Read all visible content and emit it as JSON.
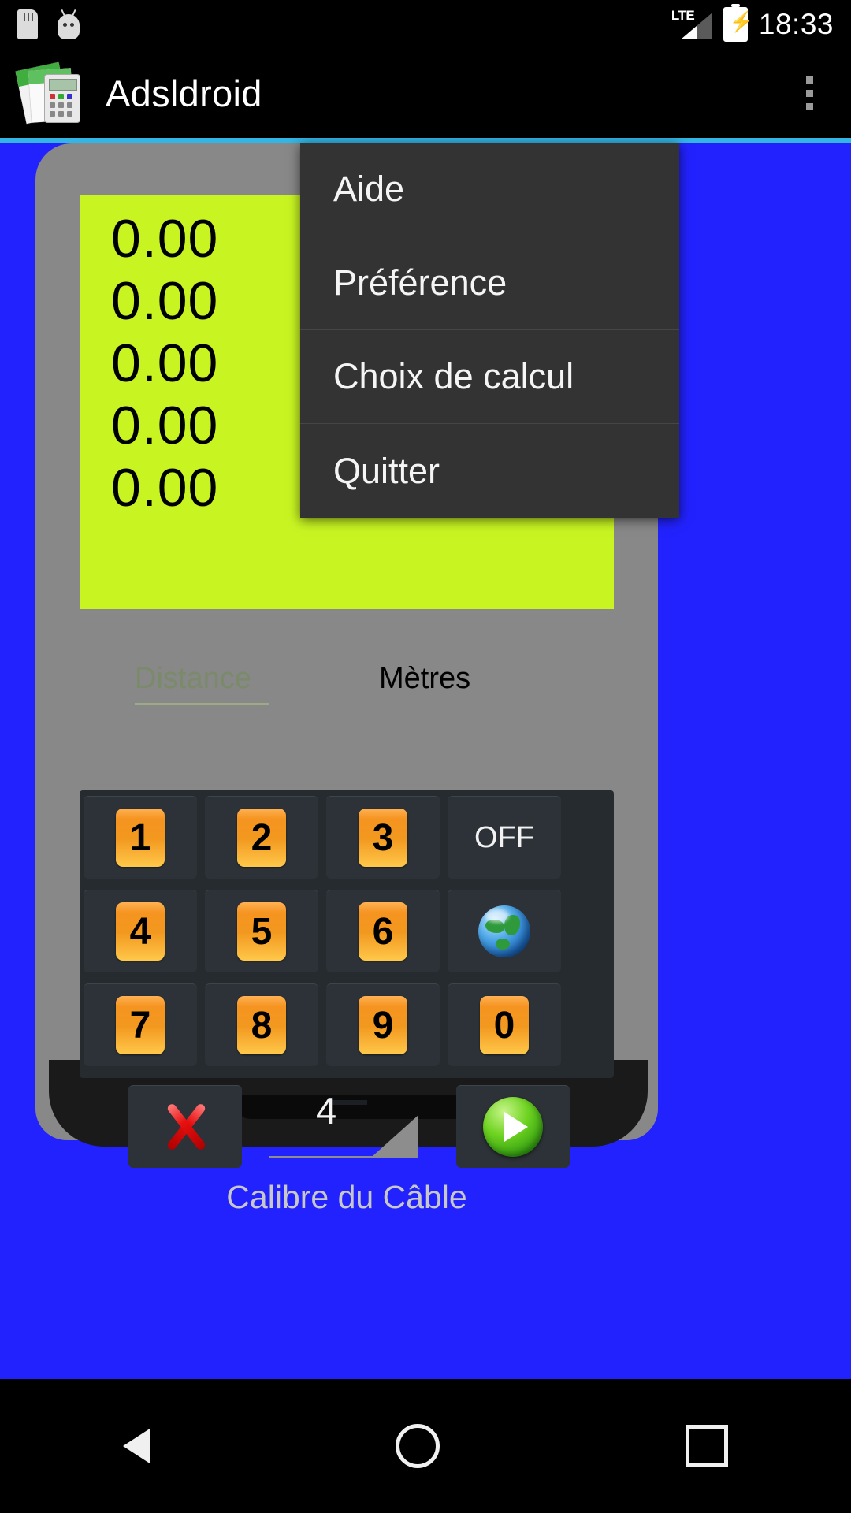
{
  "status_bar": {
    "icons": [
      "sd-card-icon",
      "android-robot-icon"
    ],
    "network_label": "LTE",
    "signal_icon": "signal-bars-icon",
    "battery_icon": "battery-charging-icon",
    "time": "18:33"
  },
  "action_bar": {
    "app_icon": "adsldroid-app-icon",
    "title": "Adsldroid",
    "overflow_icon": "overflow-menu-icon"
  },
  "overflow_menu": {
    "items": [
      {
        "label": "Aide"
      },
      {
        "label": "Préférence"
      },
      {
        "label": "Choix de calcul"
      },
      {
        "label": "Quitter"
      }
    ]
  },
  "display": {
    "background_color": "#c8f522",
    "values": [
      "0.00",
      "0.00",
      "0.00",
      "0.00",
      "0.00"
    ],
    "distance_placeholder": "Distance",
    "unit_label": "Mètres"
  },
  "keypad": {
    "rows": [
      [
        {
          "type": "digit",
          "label": "1",
          "name": "key-1"
        },
        {
          "type": "digit",
          "label": "2",
          "name": "key-2"
        },
        {
          "type": "digit",
          "label": "3",
          "name": "key-3"
        },
        {
          "type": "text",
          "label": "OFF",
          "name": "key-off"
        }
      ],
      [
        {
          "type": "digit",
          "label": "4",
          "name": "key-4"
        },
        {
          "type": "digit",
          "label": "5",
          "name": "key-5"
        },
        {
          "type": "digit",
          "label": "6",
          "name": "key-6"
        },
        {
          "type": "icon",
          "label": "globe-icon",
          "name": "key-globe"
        }
      ],
      [
        {
          "type": "digit",
          "label": "7",
          "name": "key-7"
        },
        {
          "type": "digit",
          "label": "8",
          "name": "key-8"
        },
        {
          "type": "digit",
          "label": "9",
          "name": "key-9"
        },
        {
          "type": "digit",
          "label": "0",
          "name": "key-0"
        }
      ]
    ]
  },
  "controls": {
    "clear_icon": "red-x-icon",
    "go_icon": "green-play-icon",
    "spinner_value": "4",
    "spinner_caption": "Calibre  du Câble"
  },
  "nav_bar": {
    "back": "back-triangle-icon",
    "home": "home-circle-icon",
    "recents": "recents-square-icon"
  },
  "colors": {
    "accent": "#33b5e5",
    "display_green": "#c8f522",
    "key_orange": "#f2981f",
    "background_blue": "#2222ff"
  }
}
